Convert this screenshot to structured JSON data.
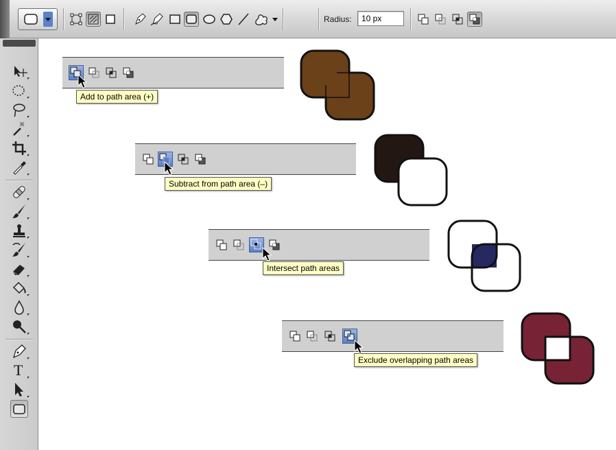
{
  "options_bar": {
    "radius_label": "Radius:",
    "radius_value": "10 px",
    "tools": [
      "shape-layers-icon",
      "paths-icon",
      "fill-pixels-icon",
      "pen-icon",
      "freeform-pen-icon",
      "rectangle-icon",
      "rounded-rectangle-icon",
      "ellipse-icon",
      "polygon-icon",
      "line-icon",
      "custom-shape-icon"
    ],
    "path_modes": [
      "add-to-path-area-icon",
      "subtract-from-path-area-icon",
      "intersect-path-areas-icon",
      "exclude-overlapping-path-areas-icon"
    ]
  },
  "tools_panel": {
    "tools": [
      "move-tool-icon",
      "elliptical-marquee-icon",
      "lasso-icon",
      "magic-wand-icon",
      "crop-icon",
      "eyedropper-icon",
      "healing-brush-icon",
      "brush-icon",
      "clone-stamp-icon",
      "history-brush-icon",
      "eraser-icon",
      "paint-bucket-icon",
      "blur-icon",
      "dodge-icon",
      "pen-tool-icon",
      "type-tool-icon",
      "path-selection-icon",
      "rounded-rectangle-tool-icon"
    ],
    "type_tool_glyph": "T"
  },
  "demos": [
    {
      "tooltip": "Add to path area (+)",
      "selected": 0,
      "fill_color": "#6b4119",
      "mode": "add"
    },
    {
      "tooltip": "Subtract from path area (–)",
      "selected": 1,
      "fill_color": "#231714",
      "mode": "subtract"
    },
    {
      "tooltip": "Intersect path areas",
      "selected": 2,
      "fill_color": "#262860",
      "mode": "intersect"
    },
    {
      "tooltip": "Exclude overlapping path areas",
      "selected": 3,
      "fill_color": "#782235",
      "mode": "exclude"
    }
  ]
}
